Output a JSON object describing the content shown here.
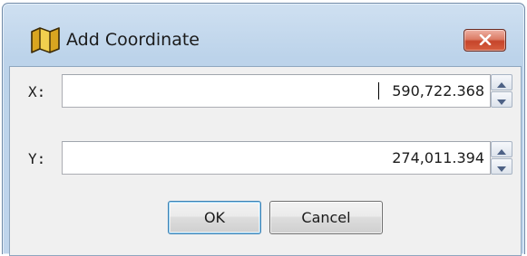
{
  "dialog": {
    "title": "Add Coordinate",
    "icon": "map-icon",
    "close_icon": "close-icon"
  },
  "fields": [
    {
      "label": "X:",
      "value": "590,722.368"
    },
    {
      "label": "Y:",
      "value": "274,011.394"
    }
  ],
  "buttons": {
    "ok_label": "OK",
    "cancel_label": "Cancel"
  },
  "colors": {
    "close_button": "#c6452b",
    "title_bar": "#bcd3ea",
    "default_button_border": "#3c7fb1"
  }
}
